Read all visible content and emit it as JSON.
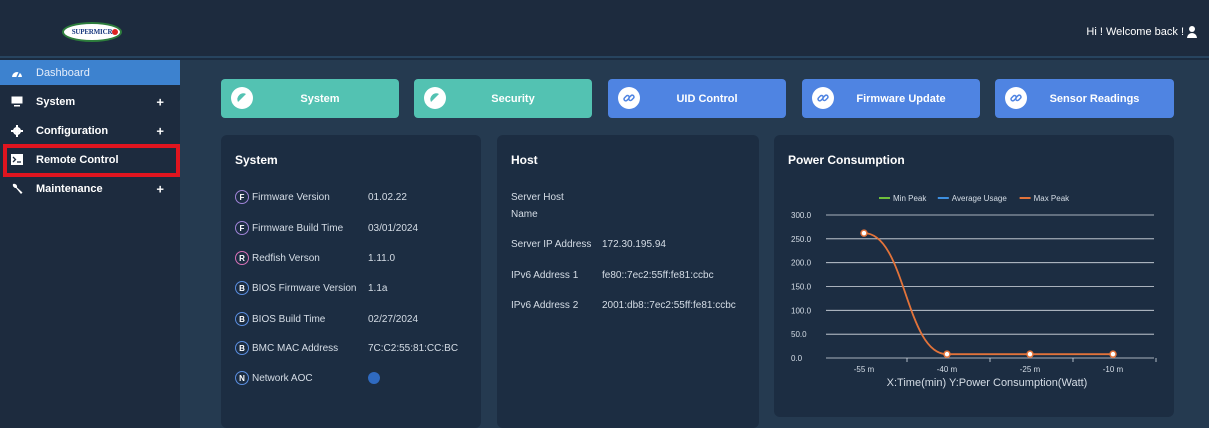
{
  "header": {
    "logo_text": "SUPERMICR",
    "welcome": "Hi ! Welcome back !"
  },
  "sidebar": {
    "items": [
      {
        "label": "Dashboard",
        "icon": "dashboard-icon",
        "expandable": false
      },
      {
        "label": "System",
        "icon": "monitor-icon",
        "expandable": true
      },
      {
        "label": "Configuration",
        "icon": "gear-icon",
        "expandable": true
      },
      {
        "label": "Remote Control",
        "icon": "terminal-icon",
        "expandable": false
      },
      {
        "label": "Maintenance",
        "icon": "wrench-icon",
        "expandable": true
      }
    ],
    "plus": "+"
  },
  "quick_buttons": [
    {
      "label": "System",
      "color": "#53c2b2"
    },
    {
      "label": "Security",
      "color": "#53c2b2"
    },
    {
      "label": "UID Control",
      "color": "#4f84e2"
    },
    {
      "label": "Firmware Update",
      "color": "#4f84e2"
    },
    {
      "label": "Sensor Readings",
      "color": "#4f84e2"
    }
  ],
  "system_card": {
    "title": "System",
    "rows": [
      {
        "badge": "F",
        "label": "Firmware Version",
        "value": "01.02.22"
      },
      {
        "badge": "F",
        "label": "Firmware Build Time",
        "value": "03/01/2024"
      },
      {
        "badge": "R",
        "label": "Redfish Verson",
        "value": "1.11.0"
      },
      {
        "badge": "B",
        "label": "BIOS Firmware Version",
        "value": "1.1a"
      },
      {
        "badge": "B",
        "label": "BIOS Build Time",
        "value": "02/27/2024"
      },
      {
        "badge": "B",
        "label": "BMC MAC Address",
        "value": "7C:C2:55:81:CC:BC"
      },
      {
        "badge": "N",
        "label": "Network AOC",
        "value": ""
      }
    ]
  },
  "host_card": {
    "title": "Host",
    "server_host_line1": "Server Host",
    "server_host_line2": "Name",
    "ip_label": "Server IP Address",
    "ip_value": "172.30.195.94",
    "ipv6_1_label": "IPv6 Address 1",
    "ipv6_1_value": "fe80::7ec2:55ff:fe81:ccbc",
    "ipv6_2_label": "IPv6 Address 2",
    "ipv6_2_value": "2001:db8::7ec2:55ff:fe81:ccbc"
  },
  "chart_data": {
    "type": "line",
    "title": "Power Consumption",
    "xlabel": "X:Time(min) Y:Power Consumption(Watt)",
    "categories": [
      "-55 m",
      "-40 m",
      "-25 m",
      "-10 m"
    ],
    "ylim": [
      0,
      300
    ],
    "yticks": [
      "300.0",
      "250.0",
      "200.0",
      "150.0",
      "100.0",
      "50.0",
      "0.0"
    ],
    "legend": [
      "Min Peak",
      "Average Usage",
      "Max Peak"
    ],
    "legend_colors": [
      "#6fbf3b",
      "#3d8fe0",
      "#e2733a"
    ],
    "series": [
      {
        "name": "Max Peak",
        "values": [
          262,
          8,
          8,
          8
        ]
      }
    ],
    "grid": true,
    "legend_position": "top"
  }
}
